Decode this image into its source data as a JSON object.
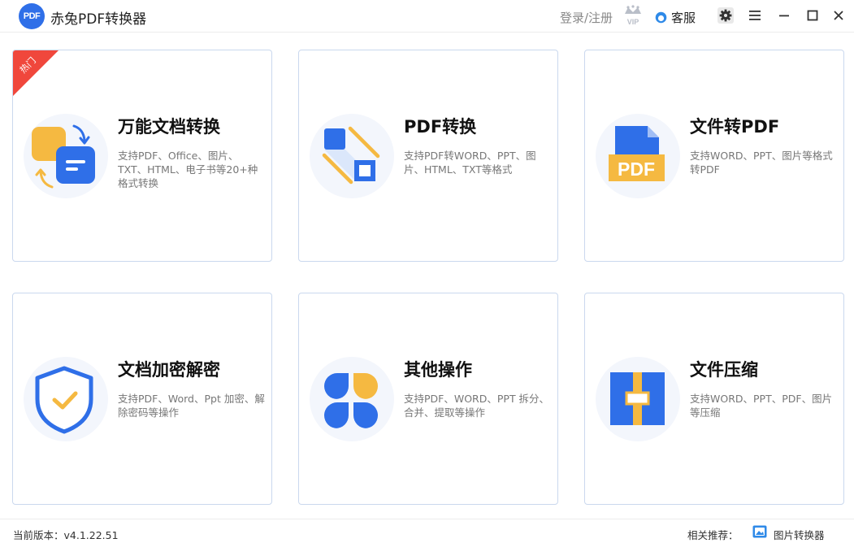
{
  "app": {
    "logo_text": "PDF",
    "title": "赤兔PDF转换器"
  },
  "header": {
    "login_label": "登录/注册",
    "vip_badge": "VIP",
    "service_label": "客服"
  },
  "cards": [
    {
      "title": "万能文档转换",
      "description": "支持PDF、Office、图片、TXT、HTML、电子书等20+种格式转换",
      "badge": "热门",
      "icon": "universal-convert-icon"
    },
    {
      "title": "PDF转换",
      "description": "支持PDF转WORD、PPT、图片、HTML、TXT等格式",
      "icon": "pdf-convert-icon"
    },
    {
      "title": "文件转PDF",
      "description": "支持WORD、PPT、图片等格式转PDF",
      "icon": "file-to-pdf-icon",
      "icon_text": "PDF"
    },
    {
      "title": "文档加密解密",
      "description": "支持PDF、Word、Ppt 加密、解除密码等操作",
      "icon": "shield-check-icon"
    },
    {
      "title": "其他操作",
      "description": "支持PDF、WORD、PPT 拆分、合并、提取等操作",
      "icon": "other-ops-icon"
    },
    {
      "title": "文件压缩",
      "description": "支持WORD、PPT、PDF、图片等压缩",
      "icon": "compress-icon"
    }
  ],
  "footer": {
    "version_label": "当前版本：v4.1.22.51",
    "related_label": "相关推荐：",
    "related_app": "图片转换器"
  },
  "colors": {
    "primary_blue": "#2f6fe8",
    "accent_yellow": "#f5b941",
    "hot_red": "#f0473c",
    "card_border": "#cad8ee"
  }
}
